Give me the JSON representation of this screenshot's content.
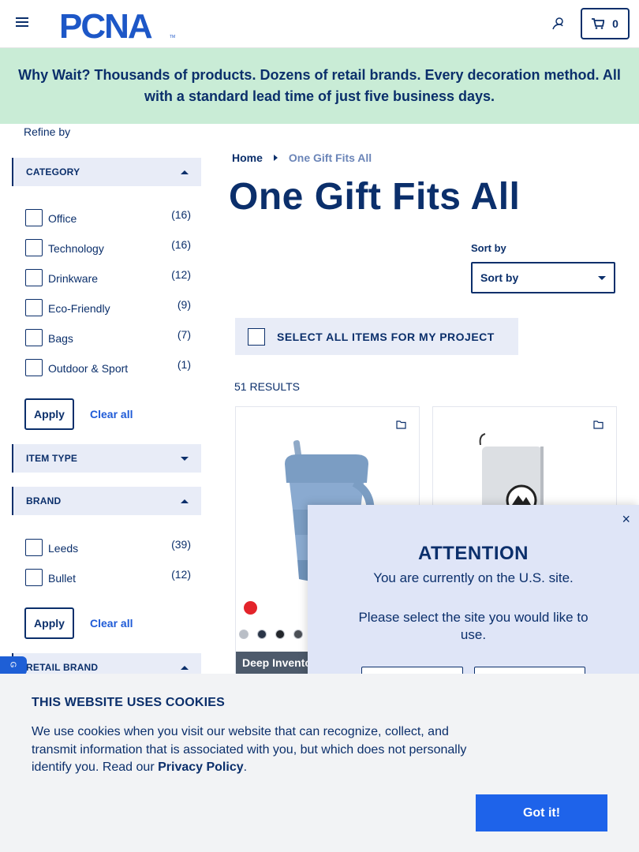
{
  "header": {
    "logo_text": "PCNA",
    "cart_count": "0"
  },
  "banner": {
    "text": "Why Wait? Thousands of products. Dozens of retail brands. Every decoration method. All with a standard lead time of just five business days."
  },
  "sidebar": {
    "refine_label": "Refine by",
    "category": {
      "label": "CATEGORY",
      "items": [
        {
          "name": "Office",
          "count": "(16)"
        },
        {
          "name": "Technology",
          "count": "(16)"
        },
        {
          "name": "Drinkware",
          "count": "(12)"
        },
        {
          "name": "Eco-Friendly",
          "count": "(9)"
        },
        {
          "name": "Bags",
          "count": "(7)"
        },
        {
          "name": "Outdoor & Sport",
          "count": "(1)"
        }
      ],
      "apply_label": "Apply",
      "clear_label": "Clear all"
    },
    "item_type": {
      "label": "ITEM TYPE"
    },
    "brand": {
      "label": "BRAND",
      "items": [
        {
          "name": "Leeds",
          "count": "(39)"
        },
        {
          "name": "Bullet",
          "count": "(12)"
        }
      ],
      "apply_label": "Apply",
      "clear_label": "Clear all"
    },
    "retail_brand": {
      "label": "RETAIL BRAND"
    }
  },
  "main": {
    "breadcrumb": {
      "home": "Home",
      "current": "One Gift Fits All"
    },
    "title": "One Gift Fits All",
    "sort_label": "Sort by",
    "sort_value": "Sort by",
    "select_all": "SELECT ALL ITEMS FOR MY PROJECT",
    "results": "51 RESULTS",
    "products": [
      {
        "tag": "Deep Invento",
        "swatches": [
          "#b9bec6",
          "#2a3547",
          "#23262b",
          "#4b4f55"
        ]
      }
    ]
  },
  "attention": {
    "title": "ATTENTION",
    "line1": "You are currently on the U.S. site.",
    "line2": "Please select the site you would like to use.",
    "close": "×"
  },
  "cookie": {
    "title": "THIS WEBSITE USES COOKIES",
    "text_before": "We use cookies when you visit our website that can recognize, collect, and transmit information that is associated with you, but which does not personally identify you. Read our ",
    "link": "Privacy Policy",
    "text_after": ".",
    "button": "Got it!"
  },
  "colors": {
    "brand_navy": "#0b2f6b",
    "accent_blue": "#1e63ea",
    "banner_green": "#c9ecd6",
    "facet_bg": "#e8ecf7"
  }
}
